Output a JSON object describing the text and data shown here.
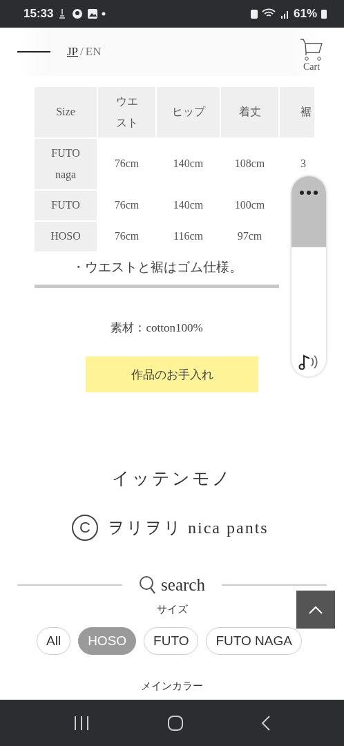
{
  "status_bar": {
    "time": "15:33",
    "battery": "61%"
  },
  "header": {
    "languages": [
      {
        "label": "JP",
        "selected": true
      },
      {
        "label": "EN",
        "selected": false
      }
    ],
    "separator": "/",
    "cart_label": "Cart"
  },
  "size_table": {
    "columns": [
      "Size",
      "ウエスト",
      "ヒップ",
      "着丈",
      "裾"
    ],
    "rows": [
      {
        "cells": [
          "FUTO naga",
          "76cm",
          "140cm",
          "108cm",
          "3"
        ]
      },
      {
        "cells": [
          "FUTO",
          "76cm",
          "140cm",
          "100cm"
        ]
      },
      {
        "cells": [
          "HOSO",
          "76cm",
          "116cm",
          "97cm"
        ]
      }
    ]
  },
  "note": "・ウエストと裾はゴム仕様。",
  "material": "素材：cotton100%",
  "care_button": "作品のお手入れ",
  "category": "イッテンモノ",
  "product": {
    "mark": "C",
    "name": "ヲリヲリ nica pants"
  },
  "search": {
    "label": "search",
    "filters": [
      {
        "title": "サイズ",
        "chips": [
          {
            "label": "All",
            "selected": false
          },
          {
            "label": "HOSO",
            "selected": true
          },
          {
            "label": "FUTO",
            "selected": false
          },
          {
            "label": "FUTO NAGA",
            "selected": false
          }
        ]
      },
      {
        "title": "メインカラー"
      }
    ]
  }
}
